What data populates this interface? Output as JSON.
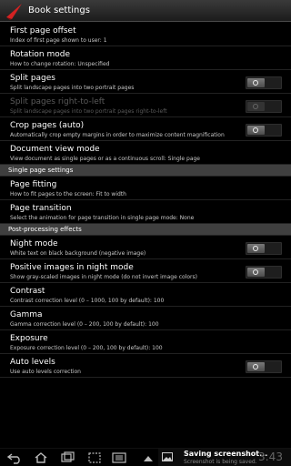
{
  "window": {
    "title": "Book settings"
  },
  "groups": [
    {
      "header": "",
      "items": [
        {
          "title": "First page offset",
          "summary": "Index of first page shown to user: 1",
          "toggle": false,
          "enabled": true
        },
        {
          "title": "Rotation mode",
          "summary": "How to change rotation: Unspecified",
          "toggle": false,
          "enabled": true
        },
        {
          "title": "Split pages",
          "summary": "Split landscape pages into two portrait pages",
          "toggle": true,
          "checked": false,
          "enabled": true
        },
        {
          "title": "Split pages right-to-left",
          "summary": "Split landscape pages into two portrait pages right-to-left",
          "toggle": true,
          "checked": false,
          "enabled": false
        },
        {
          "title": "Crop pages (auto)",
          "summary": "Automatically crop empty margins in order to maximize content magnification",
          "toggle": true,
          "checked": false,
          "enabled": true
        },
        {
          "title": "Document view mode",
          "summary": "View document as single pages or as a continuous scroll: Single page",
          "toggle": false,
          "enabled": true
        }
      ]
    },
    {
      "header": "Single page settings",
      "items": [
        {
          "title": "Page fitting",
          "summary": "How to fit pages to the screen: Fit to width",
          "toggle": false,
          "enabled": true
        },
        {
          "title": "Page transition",
          "summary": "Select the animation for page transition in single page mode: None",
          "toggle": false,
          "enabled": true
        }
      ]
    },
    {
      "header": "Post-processing effects",
      "items": [
        {
          "title": "Night mode",
          "summary": "White text on black background (negative image)",
          "toggle": true,
          "checked": false,
          "enabled": true
        },
        {
          "title": "Positive images in night mode",
          "summary": "Show gray-scaled images in night mode (do not invert image colors)",
          "toggle": true,
          "checked": false,
          "enabled": true
        },
        {
          "title": "Contrast",
          "summary": "Contrast correction level (0 – 1000, 100 by default): 100",
          "toggle": false,
          "enabled": true
        },
        {
          "title": "Gamma",
          "summary": "Gamma correction level (0 – 200, 100 by default): 100",
          "toggle": false,
          "enabled": true
        },
        {
          "title": "Exposure",
          "summary": "Exposure correction level (0 – 200, 100 by default): 100",
          "toggle": false,
          "enabled": true
        },
        {
          "title": "Auto levels",
          "summary": "Use auto levels correction",
          "toggle": true,
          "checked": false,
          "enabled": true
        }
      ]
    }
  ],
  "system_bar": {
    "notification_title": "Saving screenshot...",
    "notification_subtitle": "Screenshot is being saved.",
    "clock": "3:43"
  },
  "icons": {
    "app": "book-red-triangle-icon",
    "back": "back-icon",
    "home": "home-icon",
    "recents": "recent-apps-icon",
    "screenshot": "screenshot-icon",
    "menu": "menu-icon",
    "notification": "image-icon",
    "expand": "chevron-up-icon"
  },
  "colors": {
    "accent": "#d32222",
    "background": "#000000",
    "section": "#3f3f3f"
  }
}
